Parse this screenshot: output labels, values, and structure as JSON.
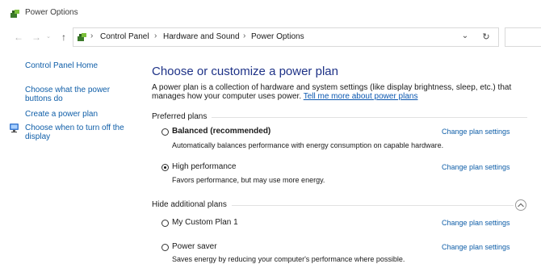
{
  "window": {
    "title": "Power Options"
  },
  "address": {
    "crumbs": [
      "Control Panel",
      "Hardware and Sound",
      "Power Options"
    ],
    "separator": "›"
  },
  "sidebar": {
    "home": "Control Panel Home",
    "items": [
      "Choose what the power buttons do",
      "Create a power plan",
      "Choose when to turn off the display"
    ]
  },
  "main": {
    "title": "Choose or customize a power plan",
    "intro": "A power plan is a collection of hardware and system settings (like display brightness, sleep, etc.) that manages how your computer uses power.",
    "intro_link": "Tell me more about power plans",
    "preferred_header": "Preferred plans",
    "additional_header": "Hide additional plans",
    "change_label": "Change plan settings",
    "plans": [
      {
        "name": "Balanced (recommended)",
        "desc": "Automatically balances performance with energy consumption on capable hardware.",
        "selected": false
      },
      {
        "name": "High performance",
        "desc": "Favors performance, but may use more energy.",
        "selected": true
      },
      {
        "name": "My Custom Plan 1",
        "desc": "",
        "selected": false
      },
      {
        "name": "Power saver",
        "desc": "Saves energy by reducing your computer's performance where possible.",
        "selected": false
      }
    ]
  },
  "colors": {
    "accent": "#0f5ea8",
    "title": "#1e3287"
  }
}
